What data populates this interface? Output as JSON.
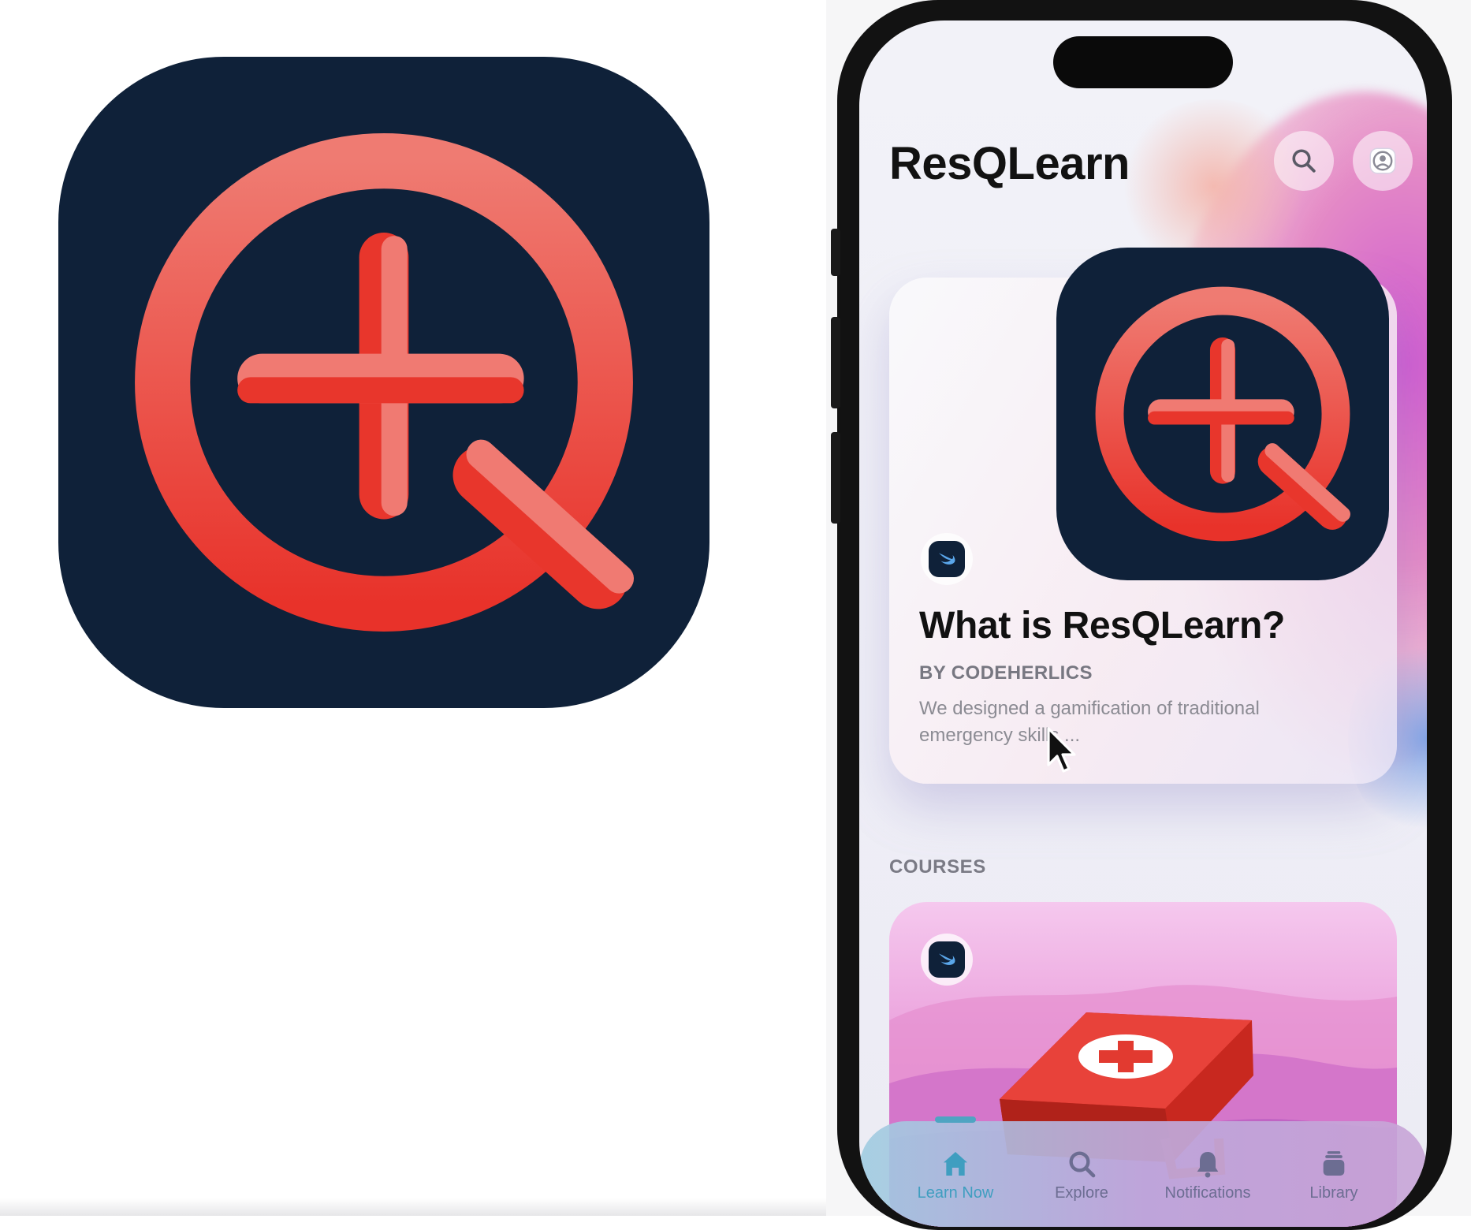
{
  "brand": {
    "icon_bg": "#0f2139",
    "accent_red": "#e8362c",
    "accent_pink": "#ef7b72"
  },
  "app": {
    "title": "ResQLearn"
  },
  "header": {
    "search_icon": "search-icon",
    "profile_icon": "profile-icon"
  },
  "featured": {
    "title": "What is ResQLearn?",
    "byline": "BY CODEHERLICS",
    "description": "We designed a gamification of traditional emergency skills ..."
  },
  "courses": {
    "section_label": "COURSES",
    "first_course_icon": "first-aid-kit"
  },
  "tabs": [
    {
      "label": "Learn Now",
      "icon": "house-icon",
      "active": true
    },
    {
      "label": "Explore",
      "icon": "search-icon",
      "active": false
    },
    {
      "label": "Notifications",
      "icon": "bell-icon",
      "active": false
    },
    {
      "label": "Library",
      "icon": "stack-icon",
      "active": false
    }
  ]
}
